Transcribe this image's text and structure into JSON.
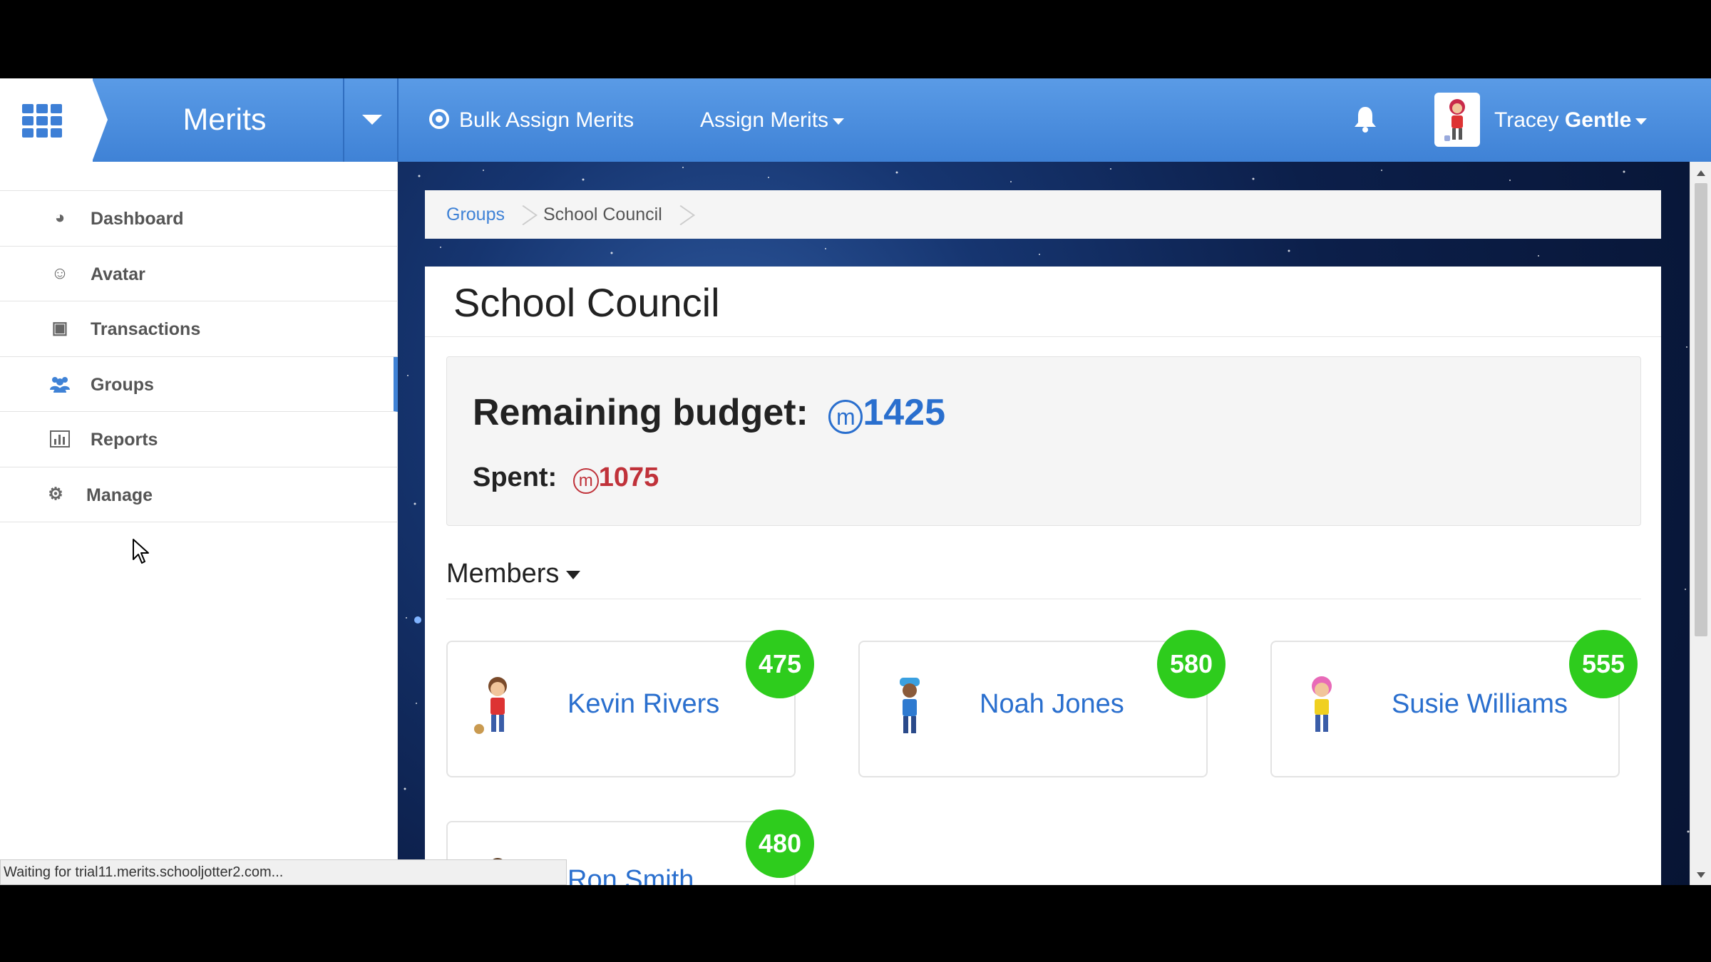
{
  "header": {
    "brand": "Merits",
    "nav": {
      "bulk_assign": "Bulk Assign Merits",
      "assign": "Assign Merits"
    },
    "user": {
      "first": "Tracey",
      "last": "Gentle"
    }
  },
  "sidebar": {
    "items": [
      {
        "label": "Dashboard",
        "icon": "dashboard-icon"
      },
      {
        "label": "Avatar",
        "icon": "smile-icon"
      },
      {
        "label": "Transactions",
        "icon": "money-icon"
      },
      {
        "label": "Groups",
        "icon": "users-icon",
        "active": true
      },
      {
        "label": "Reports",
        "icon": "bar-chart-icon"
      },
      {
        "label": "Manage",
        "icon": "gears-icon"
      }
    ]
  },
  "breadcrumb": {
    "link": "Groups",
    "current": "School Council"
  },
  "page": {
    "title": "School Council",
    "budget_label": "Remaining budget:",
    "budget_value": "1425",
    "spent_label": "Spent:",
    "spent_value": "1075",
    "merit_symbol": "m",
    "members_label": "Members"
  },
  "members": [
    {
      "name": "Kevin Rivers",
      "score": "475"
    },
    {
      "name": "Noah Jones",
      "score": "580"
    },
    {
      "name": "Susie Williams",
      "score": "555"
    },
    {
      "name": "Ron Smith",
      "score": "480"
    }
  ],
  "status": {
    "text": "Waiting for trial11.merits.schooljotter2.com..."
  },
  "colors": {
    "nav_blue": "#3f82d6",
    "badge_green": "#2ecc1d",
    "budget_blue": "#2a6fce",
    "spent_red": "#c0323a"
  }
}
